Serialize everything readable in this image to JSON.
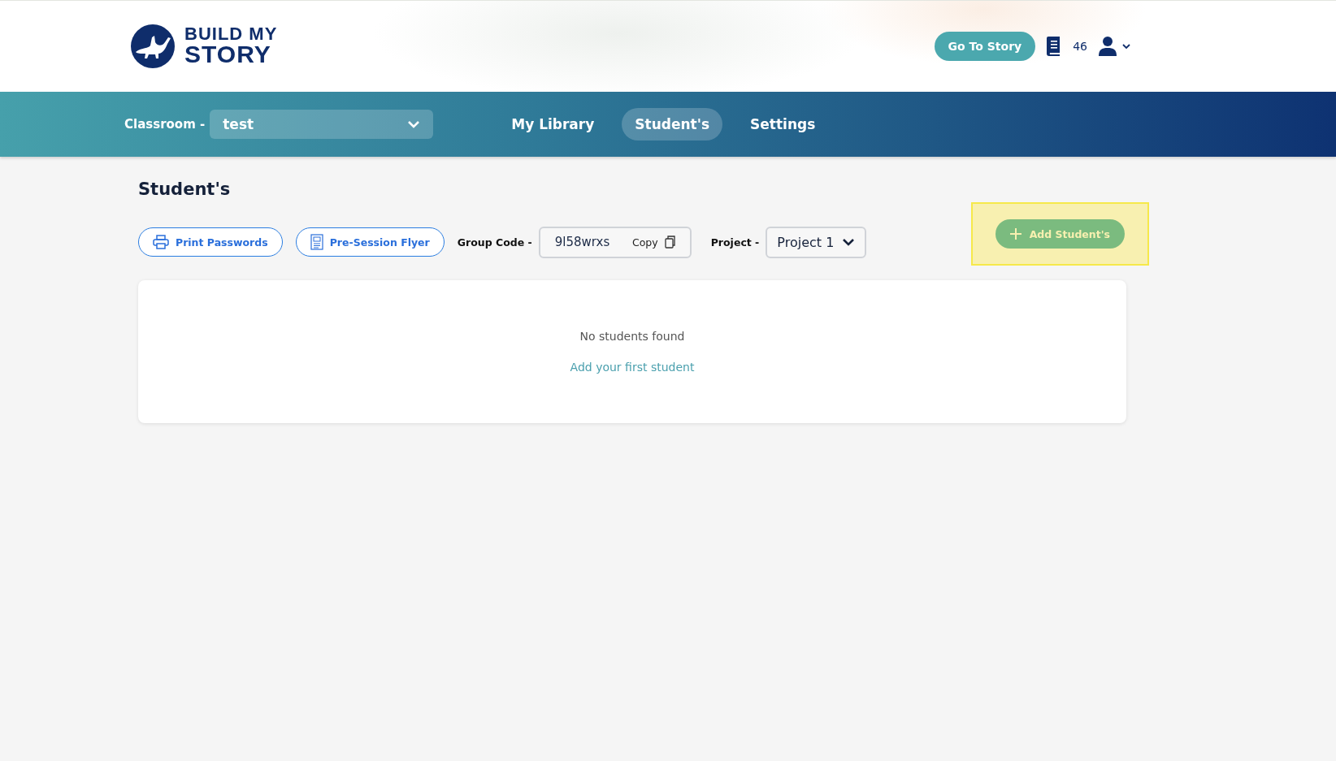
{
  "logo": {
    "line_1": "BUILD MY",
    "line_2": "STORY"
  },
  "header": {
    "story_button": "Go To Story",
    "book_count": "46"
  },
  "nav": {
    "classroom_label": "Classroom -",
    "classroom_value": "test",
    "tabs": [
      {
        "label": "My Library",
        "selected": false
      },
      {
        "label": "Student's",
        "selected": true
      },
      {
        "label": "Settings",
        "selected": false
      }
    ]
  },
  "page_title": "Student's",
  "toolbar": {
    "print_button": "Print Passwords",
    "flyer_button": "Pre-Session Flyer",
    "group_code_label": "Group Code -",
    "group_code": "9l58wrxs",
    "copy_button": "Copy",
    "project_label": "Project -",
    "project_value": "Project 1",
    "add_button": "Add Student's",
    "add_highlighted": true
  },
  "empty_state": {
    "message": "No students found",
    "link": "Add your first student"
  }
}
